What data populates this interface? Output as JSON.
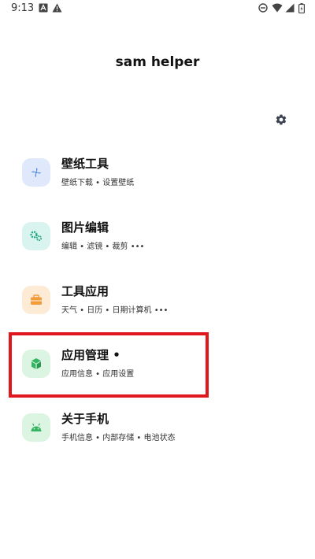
{
  "status_bar": {
    "time": "9:13",
    "icons": [
      "a-box-icon",
      "warning-icon",
      "do-not-disturb-icon",
      "wifi-icon",
      "signal-icon",
      "battery-icon"
    ]
  },
  "app": {
    "title": "sam helper"
  },
  "settings": {
    "icon": "gear-icon"
  },
  "menu": [
    {
      "title": "壁纸工具",
      "subtitle": "壁纸下载 • 设置壁纸",
      "icon": "pinwheel-icon",
      "icon_bg": "#dfe9fb",
      "icon_color": "#5a8fe6"
    },
    {
      "title": "图片编辑",
      "subtitle": "编辑 • 滤镜 • 裁剪 •••",
      "icon": "gears-icon",
      "icon_bg": "#d9f4ee",
      "icon_color": "#2aa884"
    },
    {
      "title": "工具应用",
      "subtitle": "天气 • 日历 • 日期计算机 •••",
      "icon": "toolbox-icon",
      "icon_bg": "#fdebd6",
      "icon_color": "#f29b38"
    },
    {
      "title": "应用管理 •",
      "subtitle": "应用信息 • 应用设置",
      "icon": "cube-icon",
      "icon_bg": "#dcf5e3",
      "icon_color": "#35b562"
    },
    {
      "title": "关于手机",
      "subtitle": "手机信息 • 内部存储 • 电池状态",
      "icon": "android-icon",
      "icon_bg": "#dcf5e3",
      "icon_color": "#35b562"
    }
  ],
  "highlight": {
    "color": "#e0181e"
  }
}
